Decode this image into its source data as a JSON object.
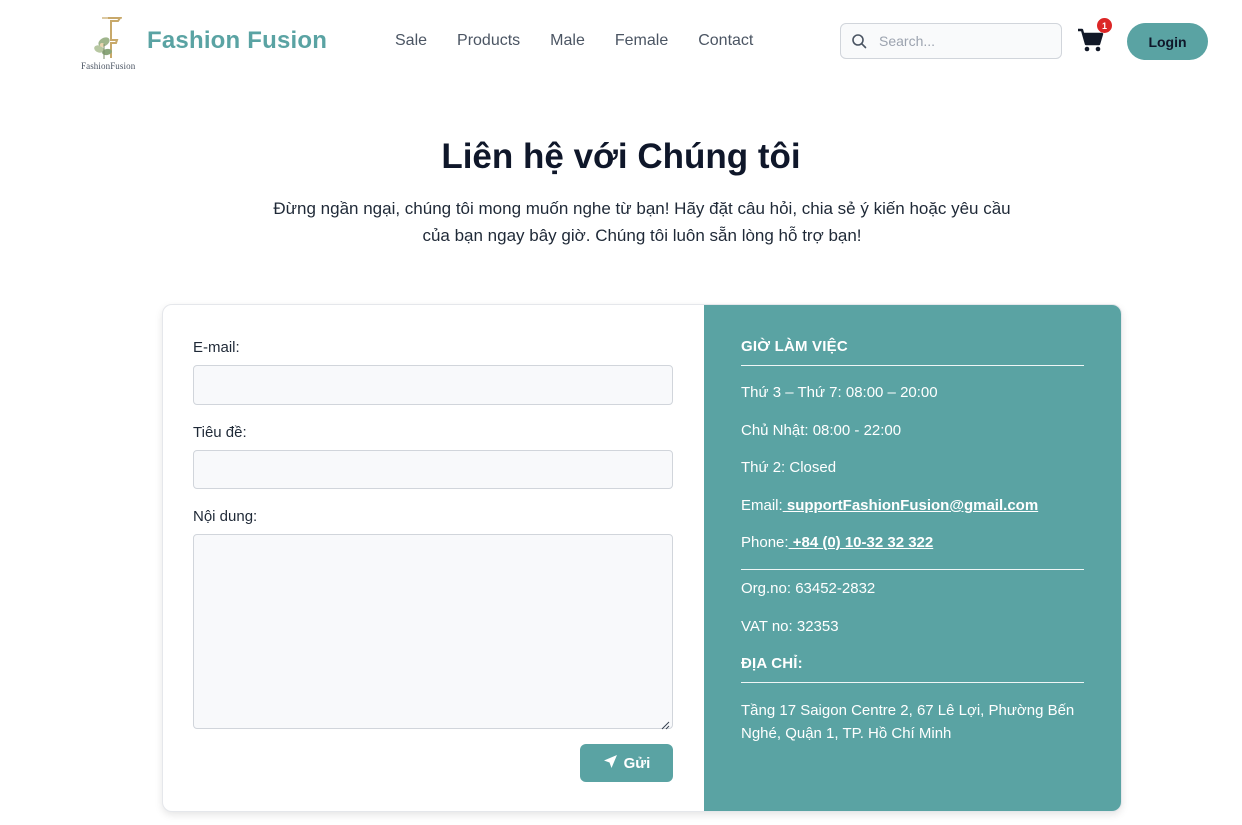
{
  "header": {
    "logo_small_text": "FashionFusion",
    "brand": "Fashion Fusion",
    "nav": [
      "Sale",
      "Products",
      "Male",
      "Female",
      "Contact"
    ],
    "search_placeholder": "Search...",
    "cart_count": "1",
    "login_label": "Login",
    "icons": [
      "search-icon",
      "cart-icon"
    ]
  },
  "hero": {
    "title": "Liên hệ với Chúng tôi",
    "subtitle_line1": "Đừng ngần ngại, chúng tôi mong muốn nghe từ bạn! Hãy đặt câu hỏi, chia sẻ ý kiến hoặc yêu cầu",
    "subtitle_line2": "của bạn ngay bây giờ. Chúng tôi luôn sẵn lòng hỗ trợ bạn!"
  },
  "form": {
    "email_label": "E-mail:",
    "subject_label": "Tiêu đề:",
    "content_label": "Nội dung:",
    "send_label": "Gửi",
    "send_icon": "send-icon"
  },
  "info": {
    "hours_heading": "GIỜ LÀM VIỆC",
    "hours": [
      "Thứ 3 – Thứ 7: 08:00 – 20:00",
      "Chủ Nhật: 08:00 - 22:00",
      "Thứ 2: Closed"
    ],
    "email_prefix": "Email:",
    "email": " supportFashionFusion@gmail.com",
    "phone_prefix": "Phone:",
    "phone": " +84 (0) 10-32 32 322",
    "org": "Org.no: 63452-2832",
    "vat": "VAT no: 32353",
    "address_heading": "ĐỊA CHỈ:",
    "address": "Tầng 17 Saigon Centre 2, 67 Lê Lợi, Phường Bến Nghé, Quận 1, TP. Hồ Chí Minh"
  },
  "colors": {
    "accent": "#5aa3a3",
    "badge": "#dc2626",
    "title": "#0f172a"
  }
}
